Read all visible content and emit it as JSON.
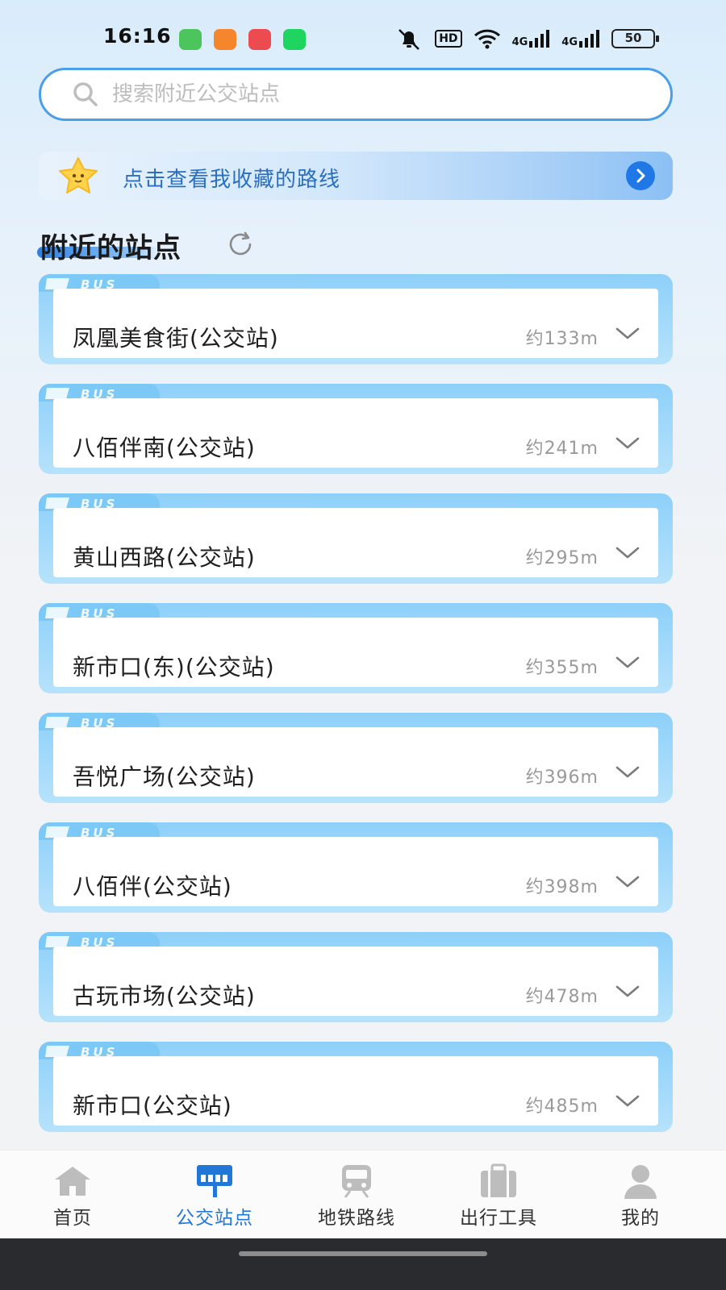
{
  "status_bar": {
    "time": "16:16",
    "hd_label": "HD",
    "signal1": "4G",
    "signal2": "4G",
    "battery": "50"
  },
  "search": {
    "placeholder": "搜索附近公交站点"
  },
  "favorites_banner": {
    "text": "点击查看我收藏的路线"
  },
  "section": {
    "title": "附近的站点"
  },
  "stations": [
    {
      "name": "凤凰美食街(公交站)",
      "distance": "约133m"
    },
    {
      "name": "八佰伴南(公交站)",
      "distance": "约241m"
    },
    {
      "name": "黄山西路(公交站)",
      "distance": "约295m"
    },
    {
      "name": "新市口(东)(公交站)",
      "distance": "约355m"
    },
    {
      "name": "吾悦广场(公交站)",
      "distance": "约396m"
    },
    {
      "name": "八佰伴(公交站)",
      "distance": "约398m"
    },
    {
      "name": "古玩市场(公交站)",
      "distance": "约478m"
    },
    {
      "name": "新市口(公交站)",
      "distance": "约485m"
    }
  ],
  "bottom_nav": {
    "items": [
      {
        "label": "首页",
        "icon": "home-icon",
        "active": false
      },
      {
        "label": "公交站点",
        "icon": "bus-stop-icon",
        "active": true
      },
      {
        "label": "地铁路线",
        "icon": "metro-icon",
        "active": false
      },
      {
        "label": "出行工具",
        "icon": "toolbox-icon",
        "active": false
      },
      {
        "label": "我的",
        "icon": "user-icon",
        "active": false
      }
    ]
  },
  "colors": {
    "accent": "#2277d6",
    "search_border": "#4a9fe8",
    "card_frame": "#8ed0fa",
    "inactive_icon": "#bdbdbd"
  }
}
